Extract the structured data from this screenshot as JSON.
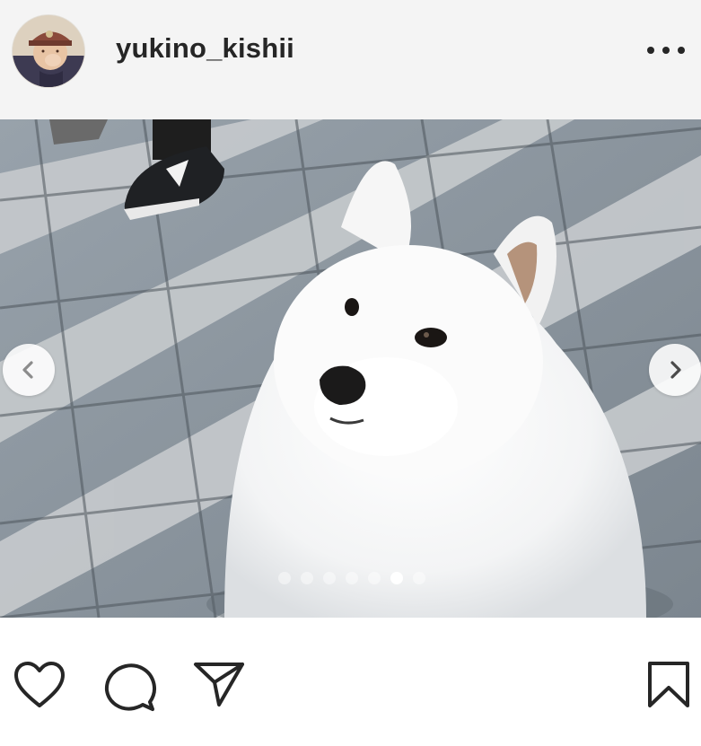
{
  "post": {
    "username": "yukino_kishii",
    "carousel": {
      "total": 7,
      "active_index": 5
    }
  },
  "icons": {
    "avatar": "profile-photo",
    "more": "more-options-icon",
    "prev": "chevron-left-icon",
    "next": "chevron-right-icon",
    "like": "heart-icon",
    "comment": "comment-bubble-icon",
    "share": "paper-plane-icon",
    "save": "bookmark-icon"
  },
  "colors": {
    "header_bg": "#f4f4f4",
    "text": "#262626",
    "dot_active": "#ffffff"
  }
}
